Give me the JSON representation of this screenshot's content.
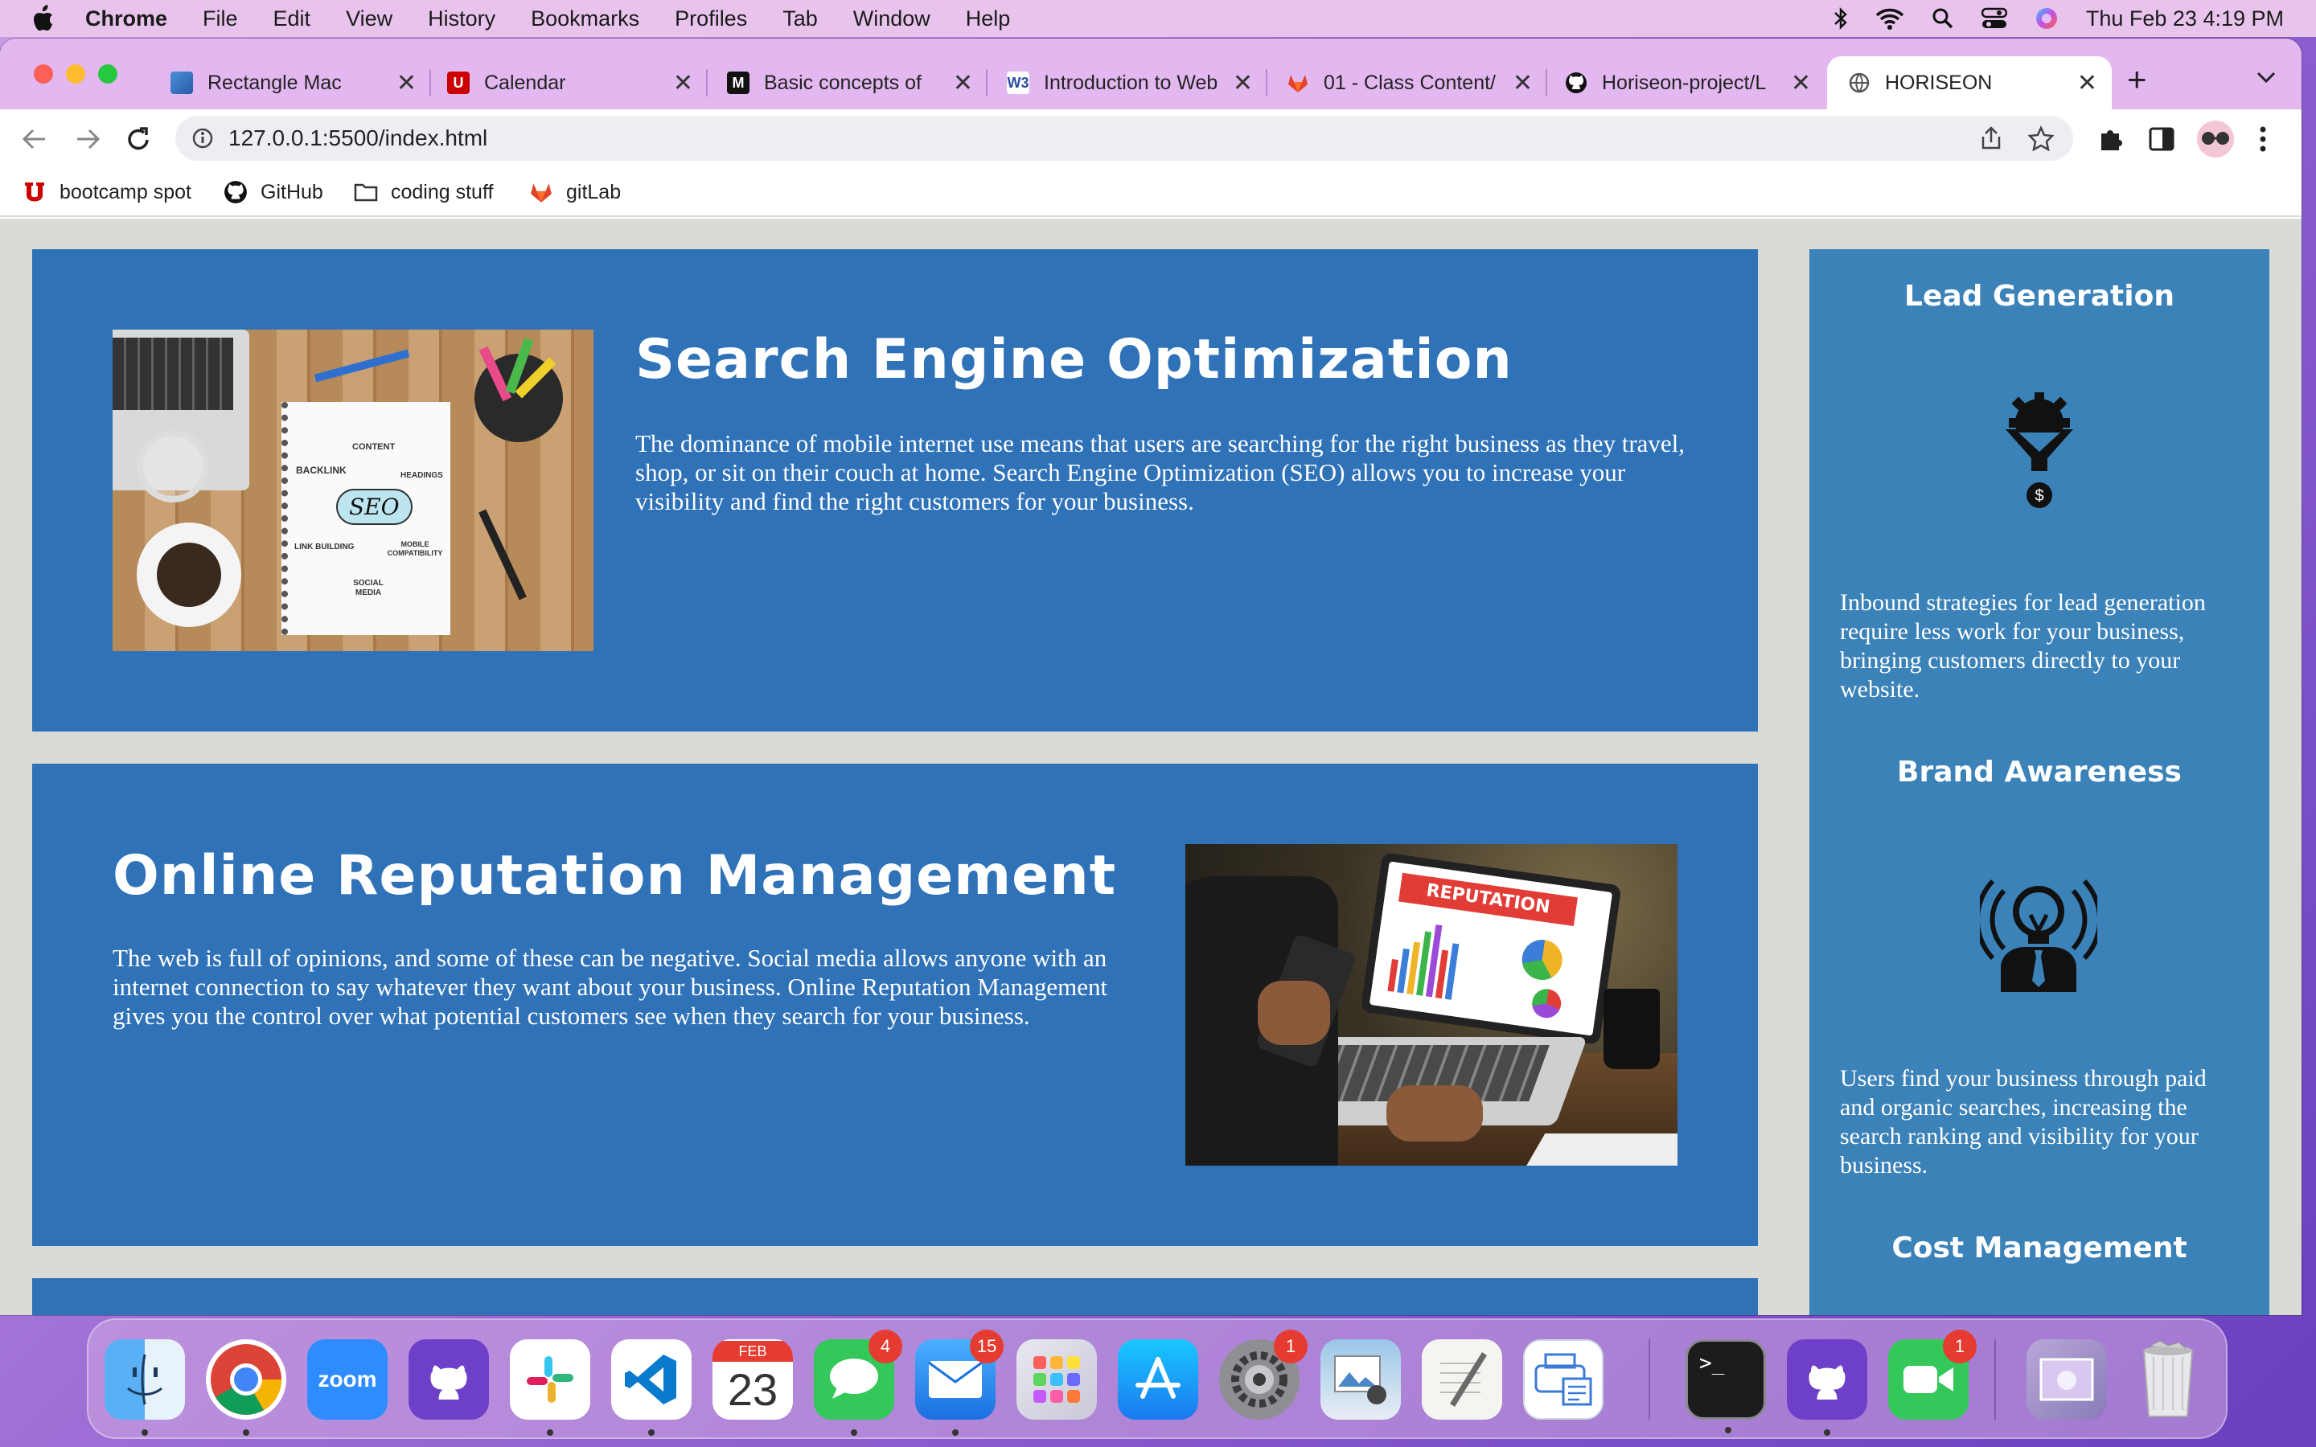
{
  "menubar": {
    "app": "Chrome",
    "items": [
      "File",
      "Edit",
      "View",
      "History",
      "Bookmarks",
      "Profiles",
      "Tab",
      "Window",
      "Help"
    ],
    "clock": "Thu Feb 23  4:19 PM"
  },
  "tabs": [
    {
      "title": "Rectangle Mac",
      "icon": "rectangle-app-icon"
    },
    {
      "title": "Calendar",
      "icon": "utah-u-icon"
    },
    {
      "title": "Basic concepts of f",
      "icon": "mdn-icon"
    },
    {
      "title": "Introduction to Web",
      "icon": "w3schools-icon"
    },
    {
      "title": "01 - Class Content/",
      "icon": "gitlab-icon"
    },
    {
      "title": "Horiseon-project/L",
      "icon": "github-icon"
    },
    {
      "title": "HORISEON",
      "icon": "globe-icon"
    }
  ],
  "tab_close_glyph": "✕",
  "new_tab_glyph": "+",
  "address": {
    "host": "127.0.0.1",
    "path": ":5500/index.html"
  },
  "bookmarks": [
    "bootcamp spot",
    "GitHub",
    "coding stuff",
    "gitLab"
  ],
  "content": {
    "seo": {
      "title": "Search Engine Optimization",
      "body": "The dominance of mobile internet use means that users are searching for the right business as they travel, shop, or sit on their couch at home. Search Engine Optimization (SEO) allows you to increase your visibility and find the right customers for your business.",
      "image_words": [
        "CONTENT",
        "BACKLINK",
        "HEADINGS",
        "SEO",
        "LINK BUILDING",
        "MOBILE COMPATIBILITY",
        "SOCIAL MEDIA"
      ]
    },
    "orm": {
      "title": "Online Reputation Management",
      "body": "The web is full of opinions, and some of these can be negative. Social media allows anyone with an internet connection to say whatever they want about your business. Online Reputation Management gives you the control over what potential customers see when they search for your business.",
      "image_word": "REPUTATION"
    }
  },
  "sidebar": {
    "lead": {
      "title": "Lead Generation",
      "body": "Inbound strategies for lead generation require less work for your business, bringing customers directly to your website."
    },
    "brand": {
      "title": "Brand Awareness",
      "body": "Users find your business through paid and organic searches, increasing the search ranking and visibility for your business."
    },
    "cost": {
      "title": "Cost Management"
    }
  },
  "dock": {
    "zoom_label": "zoom",
    "calendar_month": "FEB",
    "calendar_day": "23",
    "badges": {
      "messages": "4",
      "mail": "15",
      "settings": "1",
      "facetime": "1"
    },
    "terminal_prompt": ">_"
  }
}
